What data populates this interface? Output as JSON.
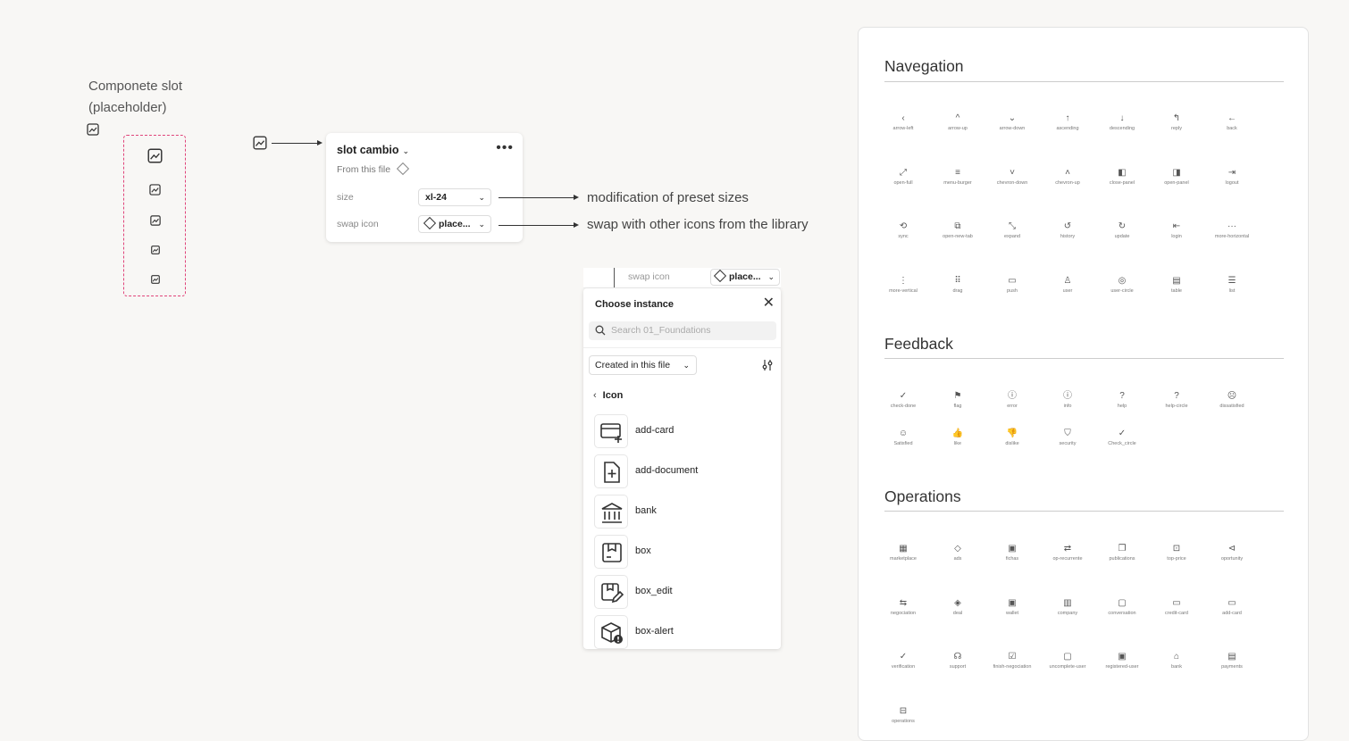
{
  "slot": {
    "title_line1": "Componete slot",
    "title_line2": "(placeholder)"
  },
  "props_panel": {
    "title": "slot cambio",
    "source": "From this file",
    "more_icon": "more-horizontal-icon",
    "size_label": "size",
    "size_value": "xl-24",
    "swap_label": "swap icon",
    "swap_value": "place..."
  },
  "notes": {
    "size_note": "modification of preset sizes",
    "swap_note": "swap with other icons from the library"
  },
  "choose_instance": {
    "top_label": "swap icon",
    "top_value": "place...",
    "title": "Choose instance",
    "search_placeholder": "Search 01_Foundations",
    "filter": "Created in this file",
    "back_label": "Icon",
    "items": [
      {
        "name": "add-card",
        "icon": "add-card-icon"
      },
      {
        "name": "add-document",
        "icon": "add-document-icon"
      },
      {
        "name": "bank",
        "icon": "bank-icon"
      },
      {
        "name": "box",
        "icon": "box-icon"
      },
      {
        "name": "box_edit",
        "icon": "box-edit-icon"
      },
      {
        "name": "box-alert",
        "icon": "box-alert-icon"
      }
    ]
  },
  "library": {
    "sections": [
      {
        "title": "Navegation",
        "icons": [
          {
            "glyph": "‹",
            "label": "arrow-left"
          },
          {
            "glyph": "^",
            "label": "arrow-up"
          },
          {
            "glyph": "⌄",
            "label": "arrow-down"
          },
          {
            "glyph": "↑",
            "label": "ascending"
          },
          {
            "glyph": "↓",
            "label": "descending"
          },
          {
            "glyph": "↰",
            "label": "reply"
          },
          {
            "glyph": "←",
            "label": "back"
          },
          {
            "glyph": "⤢",
            "label": "open-full"
          },
          {
            "glyph": "≡",
            "label": "menu-burger"
          },
          {
            "glyph": "˅",
            "label": "chevron-down"
          },
          {
            "glyph": "˄",
            "label": "chevron-up"
          },
          {
            "glyph": "◧",
            "label": "close-panel"
          },
          {
            "glyph": "◨",
            "label": "open-panel"
          },
          {
            "glyph": "⇥",
            "label": "logout"
          },
          {
            "glyph": "⟲",
            "label": "sync"
          },
          {
            "glyph": "⧉",
            "label": "open-new-tab"
          },
          {
            "glyph": "⤡",
            "label": "expand"
          },
          {
            "glyph": "↺",
            "label": "history"
          },
          {
            "glyph": "↻",
            "label": "update"
          },
          {
            "glyph": "⇤",
            "label": "login"
          },
          {
            "glyph": "···",
            "label": "more-horizontal"
          },
          {
            "glyph": "⋮",
            "label": "more-vertical"
          },
          {
            "glyph": "⠿",
            "label": "drag"
          },
          {
            "glyph": "▭",
            "label": "push"
          },
          {
            "glyph": "♙",
            "label": "user"
          },
          {
            "glyph": "◎",
            "label": "user-circle"
          },
          {
            "glyph": "▤",
            "label": "table"
          },
          {
            "glyph": "☰",
            "label": "list"
          }
        ]
      },
      {
        "title": "Feedback",
        "icons": [
          {
            "glyph": "✓",
            "label": "check-done"
          },
          {
            "glyph": "⚑",
            "label": "flag"
          },
          {
            "glyph": "ⓘ",
            "label": "error"
          },
          {
            "glyph": "ⓘ",
            "label": "info"
          },
          {
            "glyph": "?",
            "label": "help"
          },
          {
            "glyph": "?",
            "label": "help-circle"
          },
          {
            "glyph": "☹",
            "label": "dissatisfied"
          },
          {
            "glyph": "☺",
            "label": "Satisfied"
          },
          {
            "glyph": "👍",
            "label": "like"
          },
          {
            "glyph": "👎",
            "label": "dislike"
          },
          {
            "glyph": "⛉",
            "label": "security"
          },
          {
            "glyph": "✓",
            "label": "Check_circle"
          }
        ]
      },
      {
        "title": "Operations",
        "icons": [
          {
            "glyph": "▦",
            "label": "marketplace"
          },
          {
            "glyph": "◇",
            "label": "ads"
          },
          {
            "glyph": "▣",
            "label": "fichas"
          },
          {
            "glyph": "⇄",
            "label": "op-recurrente"
          },
          {
            "glyph": "❐",
            "label": "publications"
          },
          {
            "glyph": "⊡",
            "label": "top-price"
          },
          {
            "glyph": "⊲",
            "label": "oportunity"
          },
          {
            "glyph": "⇆",
            "label": "negociation"
          },
          {
            "glyph": "◈",
            "label": "deal"
          },
          {
            "glyph": "▣",
            "label": "wallet"
          },
          {
            "glyph": "▥",
            "label": "company"
          },
          {
            "glyph": "▢",
            "label": "conversation"
          },
          {
            "glyph": "▭",
            "label": "credit-card"
          },
          {
            "glyph": "▭",
            "label": "add-card"
          },
          {
            "glyph": "✓",
            "label": "verification"
          },
          {
            "glyph": "☊",
            "label": "support"
          },
          {
            "glyph": "☑",
            "label": "finish-negociation"
          },
          {
            "glyph": "▢",
            "label": "uncomplete-user"
          },
          {
            "glyph": "▣",
            "label": "registered-user"
          },
          {
            "glyph": "⌂",
            "label": "bank"
          },
          {
            "glyph": "▤",
            "label": "payments"
          },
          {
            "glyph": "⊟",
            "label": "operations"
          }
        ]
      }
    ]
  }
}
